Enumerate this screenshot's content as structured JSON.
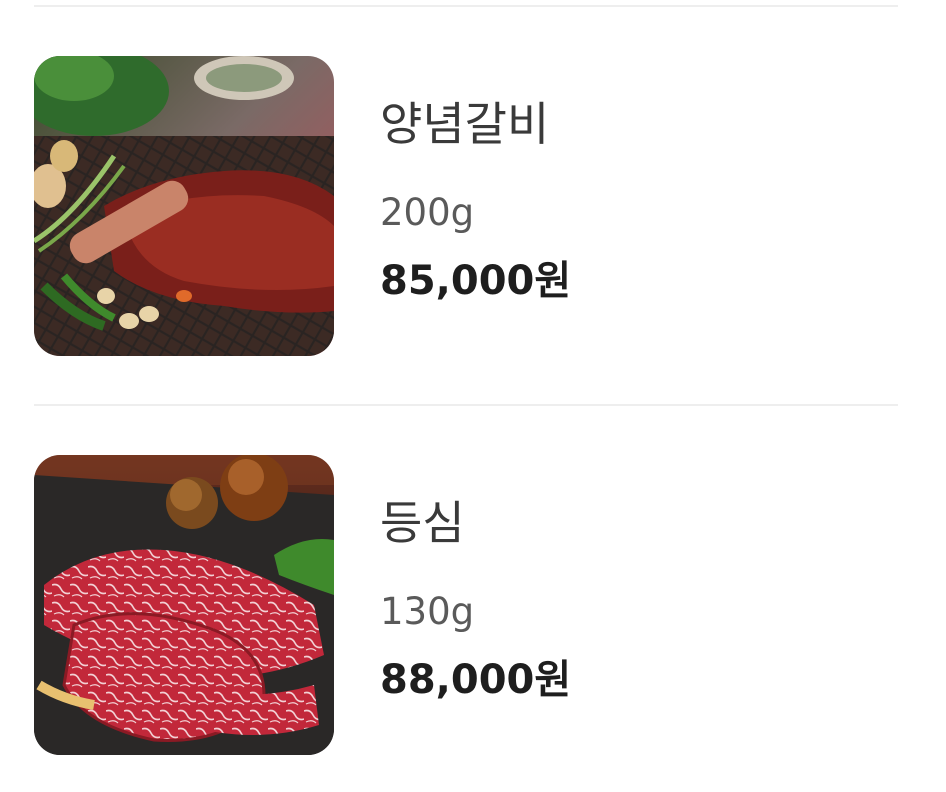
{
  "menu": {
    "items": [
      {
        "name": "양념갈비",
        "weight": "200g",
        "price": "85,000원",
        "image_icon": "grilled-galbi-photo"
      },
      {
        "name": "등심",
        "weight": "130g",
        "price": "88,000원",
        "image_icon": "sirloin-beef-photo"
      }
    ]
  }
}
